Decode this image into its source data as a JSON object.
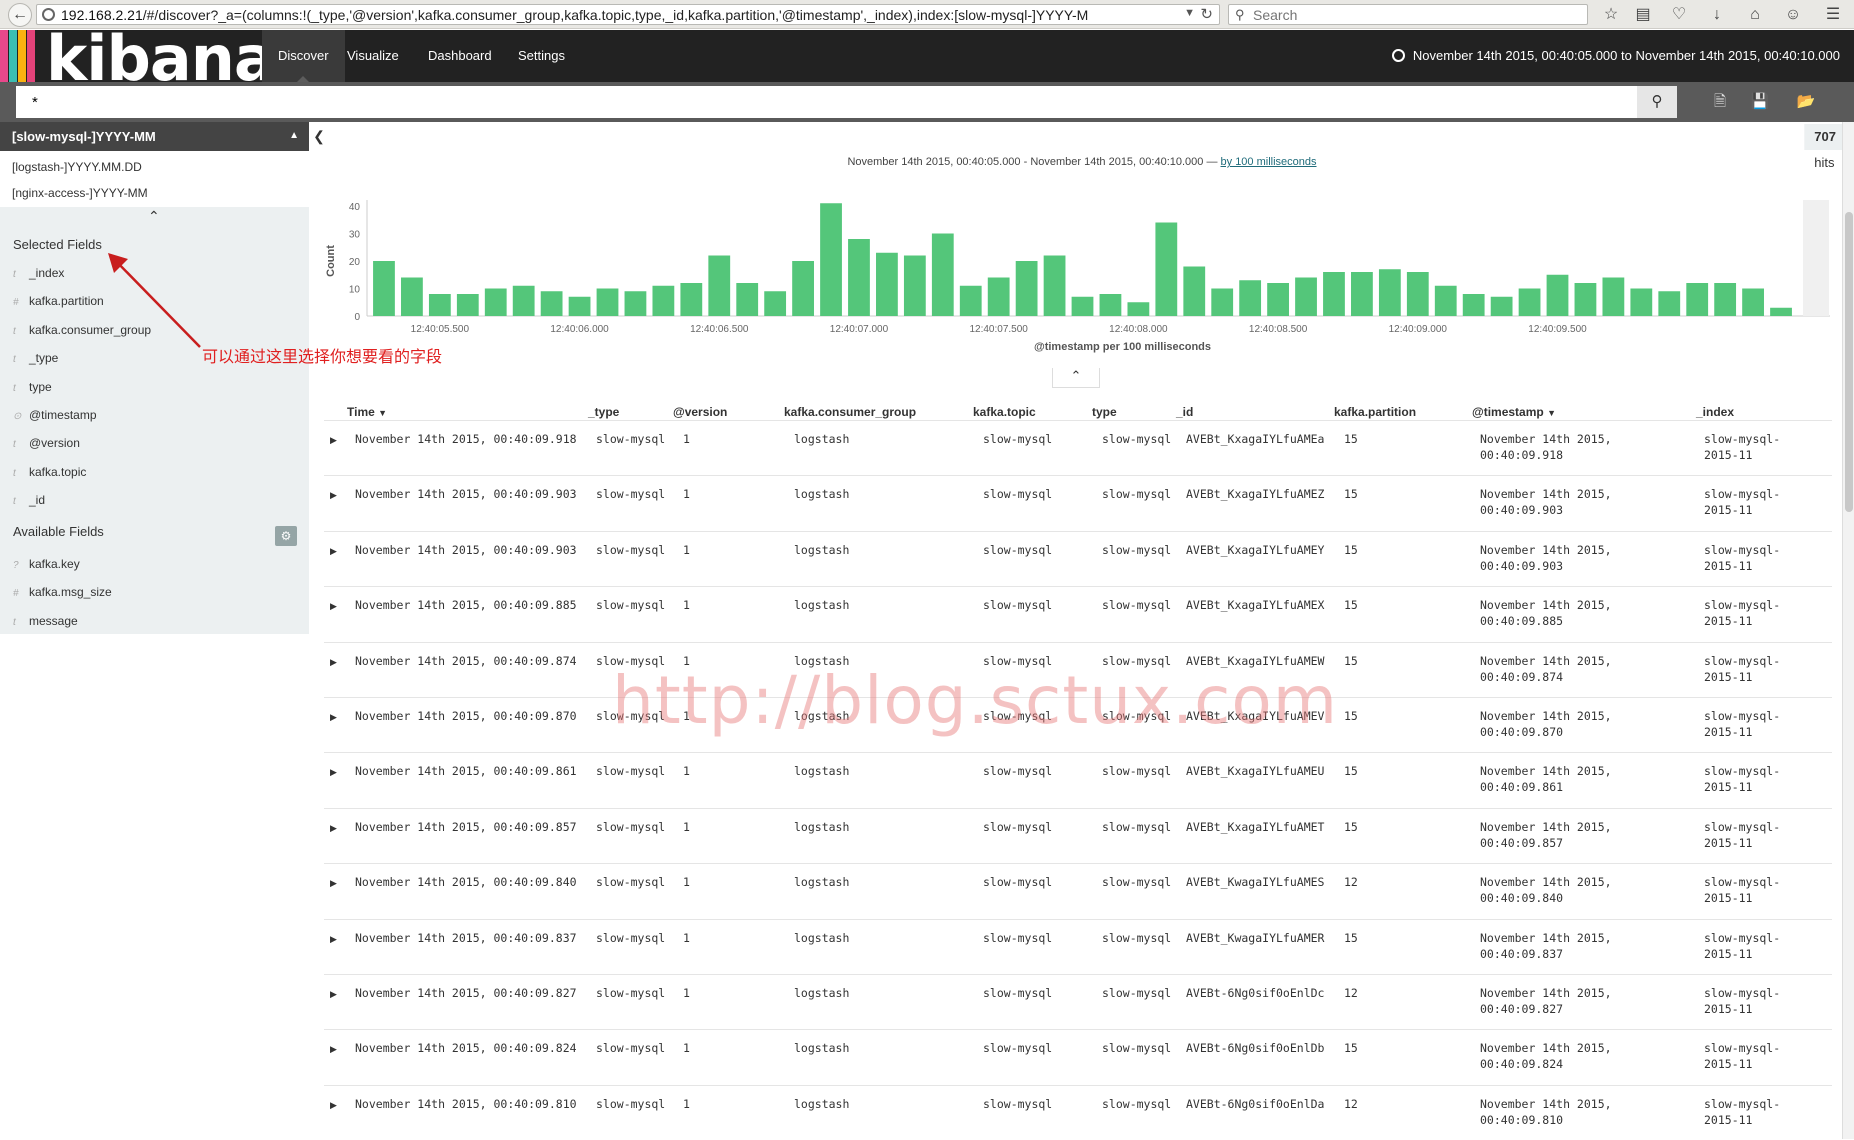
{
  "browser": {
    "url_host": "192.168.2.21",
    "url_rest": "/#/discover?_a=(columns:!(_type,'@version',kafka.consumer_group,kafka.topic,type,_id,kafka.partition,'@timestamp',_index),index:[slow-mysql-]YYYY-M",
    "search_placeholder": "Search"
  },
  "navbar": {
    "logo": "kibana",
    "tabs": [
      "Discover",
      "Visualize",
      "Dashboard",
      "Settings"
    ],
    "time_range": "November 14th 2015, 00:40:05.000 to November 14th 2015, 00:40:10.000"
  },
  "query": {
    "value": "*"
  },
  "sidebar": {
    "selected_index": "[slow-mysql-]YYYY-MM",
    "index_options": [
      "[logstash-]YYYY.MM.DD",
      "[nginx-access-]YYYY-MM"
    ],
    "selected_fields_title": "Selected Fields",
    "selected_fields": [
      {
        "type": "t",
        "name": "_index"
      },
      {
        "type": "#",
        "name": "kafka.partition"
      },
      {
        "type": "t",
        "name": "kafka.consumer_group"
      },
      {
        "type": "t",
        "name": "_type"
      },
      {
        "type": "t",
        "name": "type"
      },
      {
        "type": "⊙",
        "name": "@timestamp"
      },
      {
        "type": "t",
        "name": "@version"
      },
      {
        "type": "t",
        "name": "kafka.topic"
      },
      {
        "type": "t",
        "name": "_id"
      }
    ],
    "available_fields_title": "Available Fields",
    "available_fields": [
      {
        "type": "?",
        "name": "kafka.key"
      },
      {
        "type": "#",
        "name": "kafka.msg_size"
      },
      {
        "type": "t",
        "name": "message"
      }
    ]
  },
  "annotation": "可以通过这里选择你想要看的字段",
  "hits": {
    "count": "707",
    "label": "hits"
  },
  "time_caption": {
    "text": "November 14th 2015, 00:40:05.000 - November 14th 2015, 00:40:10.000 —",
    "link": "by 100 milliseconds"
  },
  "chart_data": {
    "type": "bar",
    "ylabel": "Count",
    "xlabel": "@timestamp per 100 milliseconds",
    "ylim": [
      0,
      40
    ],
    "yticks": [
      0,
      10,
      20,
      30,
      40
    ],
    "x_tick_labels": [
      "12:40:05.500",
      "12:40:06.000",
      "12:40:06.500",
      "12:40:07.000",
      "12:40:07.500",
      "12:40:08.000",
      "12:40:08.500",
      "12:40:09.000",
      "12:40:09.500"
    ],
    "values": [
      20,
      14,
      8,
      8,
      10,
      11,
      9,
      7,
      10,
      9,
      11,
      12,
      22,
      12,
      9,
      20,
      41,
      28,
      23,
      22,
      30,
      11,
      14,
      20,
      22,
      7,
      8,
      5,
      34,
      18,
      10,
      13,
      12,
      14,
      16,
      16,
      17,
      16,
      11,
      8,
      7,
      10,
      15,
      12,
      14,
      10,
      9,
      12,
      12,
      10,
      3
    ],
    "bar_color": "#54c67a"
  },
  "table": {
    "columns": [
      "Time",
      "_type",
      "@version",
      "kafka.consumer_group",
      "kafka.topic",
      "type",
      "_id",
      "kafka.partition",
      "@timestamp",
      "_index"
    ],
    "rows": [
      {
        "time": "November 14th 2015, 00:40:09.918",
        "_type": "slow-mysql",
        "version": "1",
        "group": "logstash",
        "topic": "slow-mysql",
        "type": "slow-mysql",
        "id": "AVEBt_KxagaIYLfuAMEa",
        "partition": "15",
        "ts1": "November 14th 2015,",
        "ts2": "00:40:09.918",
        "idx1": "slow-mysql-",
        "idx2": "2015-11"
      },
      {
        "time": "November 14th 2015, 00:40:09.903",
        "_type": "slow-mysql",
        "version": "1",
        "group": "logstash",
        "topic": "slow-mysql",
        "type": "slow-mysql",
        "id": "AVEBt_KxagaIYLfuAMEZ",
        "partition": "15",
        "ts1": "November 14th 2015,",
        "ts2": "00:40:09.903",
        "idx1": "slow-mysql-",
        "idx2": "2015-11"
      },
      {
        "time": "November 14th 2015, 00:40:09.903",
        "_type": "slow-mysql",
        "version": "1",
        "group": "logstash",
        "topic": "slow-mysql",
        "type": "slow-mysql",
        "id": "AVEBt_KxagaIYLfuAMEY",
        "partition": "15",
        "ts1": "November 14th 2015,",
        "ts2": "00:40:09.903",
        "idx1": "slow-mysql-",
        "idx2": "2015-11"
      },
      {
        "time": "November 14th 2015, 00:40:09.885",
        "_type": "slow-mysql",
        "version": "1",
        "group": "logstash",
        "topic": "slow-mysql",
        "type": "slow-mysql",
        "id": "AVEBt_KxagaIYLfuAMEX",
        "partition": "15",
        "ts1": "November 14th 2015,",
        "ts2": "00:40:09.885",
        "idx1": "slow-mysql-",
        "idx2": "2015-11"
      },
      {
        "time": "November 14th 2015, 00:40:09.874",
        "_type": "slow-mysql",
        "version": "1",
        "group": "logstash",
        "topic": "slow-mysql",
        "type": "slow-mysql",
        "id": "AVEBt_KxagaIYLfuAMEW",
        "partition": "15",
        "ts1": "November 14th 2015,",
        "ts2": "00:40:09.874",
        "idx1": "slow-mysql-",
        "idx2": "2015-11"
      },
      {
        "time": "November 14th 2015, 00:40:09.870",
        "_type": "slow-mysql",
        "version": "1",
        "group": "logstash",
        "topic": "slow-mysql",
        "type": "slow-mysql",
        "id": "AVEBt_KxagaIYLfuAMEV",
        "partition": "15",
        "ts1": "November 14th 2015,",
        "ts2": "00:40:09.870",
        "idx1": "slow-mysql-",
        "idx2": "2015-11"
      },
      {
        "time": "November 14th 2015, 00:40:09.861",
        "_type": "slow-mysql",
        "version": "1",
        "group": "logstash",
        "topic": "slow-mysql",
        "type": "slow-mysql",
        "id": "AVEBt_KxagaIYLfuAMEU",
        "partition": "15",
        "ts1": "November 14th 2015,",
        "ts2": "00:40:09.861",
        "idx1": "slow-mysql-",
        "idx2": "2015-11"
      },
      {
        "time": "November 14th 2015, 00:40:09.857",
        "_type": "slow-mysql",
        "version": "1",
        "group": "logstash",
        "topic": "slow-mysql",
        "type": "slow-mysql",
        "id": "AVEBt_KxagaIYLfuAMET",
        "partition": "15",
        "ts1": "November 14th 2015,",
        "ts2": "00:40:09.857",
        "idx1": "slow-mysql-",
        "idx2": "2015-11"
      },
      {
        "time": "November 14th 2015, 00:40:09.840",
        "_type": "slow-mysql",
        "version": "1",
        "group": "logstash",
        "topic": "slow-mysql",
        "type": "slow-mysql",
        "id": "AVEBt_KwagaIYLfuAMES",
        "partition": "12",
        "ts1": "November 14th 2015,",
        "ts2": "00:40:09.840",
        "idx1": "slow-mysql-",
        "idx2": "2015-11"
      },
      {
        "time": "November 14th 2015, 00:40:09.837",
        "_type": "slow-mysql",
        "version": "1",
        "group": "logstash",
        "topic": "slow-mysql",
        "type": "slow-mysql",
        "id": "AVEBt_KwagaIYLfuAMER",
        "partition": "15",
        "ts1": "November 14th 2015,",
        "ts2": "00:40:09.837",
        "idx1": "slow-mysql-",
        "idx2": "2015-11"
      },
      {
        "time": "November 14th 2015, 00:40:09.827",
        "_type": "slow-mysql",
        "version": "1",
        "group": "logstash",
        "topic": "slow-mysql",
        "type": "slow-mysql",
        "id": "AVEBt-6Ng0sif0oEnlDc",
        "partition": "12",
        "ts1": "November 14th 2015,",
        "ts2": "00:40:09.827",
        "idx1": "slow-mysql-",
        "idx2": "2015-11"
      },
      {
        "time": "November 14th 2015, 00:40:09.824",
        "_type": "slow-mysql",
        "version": "1",
        "group": "logstash",
        "topic": "slow-mysql",
        "type": "slow-mysql",
        "id": "AVEBt-6Ng0sif0oEnlDb",
        "partition": "15",
        "ts1": "November 14th 2015,",
        "ts2": "00:40:09.824",
        "idx1": "slow-mysql-",
        "idx2": "2015-11"
      },
      {
        "time": "November 14th 2015, 00:40:09.810",
        "_type": "slow-mysql",
        "version": "1",
        "group": "logstash",
        "topic": "slow-mysql",
        "type": "slow-mysql",
        "id": "AVEBt-6Ng0sif0oEnlDa",
        "partition": "12",
        "ts1": "November 14th 2015,",
        "ts2": "00:40:09.810",
        "idx1": "slow-mysql-",
        "idx2": "2015-11"
      }
    ]
  },
  "watermark": "http://blog.sctux.com",
  "colors": {
    "navbar": "#222222",
    "querybar": "#5a5a5a",
    "sidebar_header": "#444444",
    "sidebar_bg": "#ecf0f1",
    "bar": "#54c67a",
    "annotation": "#e02020"
  }
}
